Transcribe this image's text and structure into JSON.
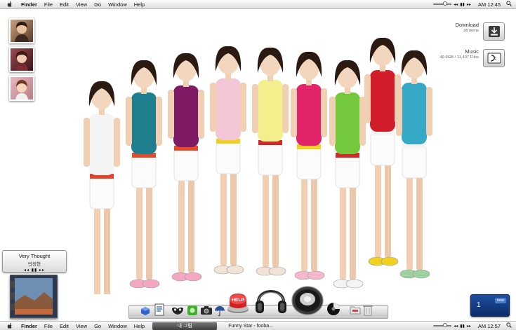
{
  "top_menubar": {
    "apple_icon": "apple-icon",
    "app_name": "Finder",
    "menu": [
      "File",
      "Edit",
      "View",
      "Go",
      "Window",
      "Help"
    ],
    "clock": "AM 12:45",
    "spotlight_icon": "magnifier-icon"
  },
  "bottom_menubar": {
    "apple_icon": "apple-icon",
    "app_name": "Finder",
    "menu": [
      "File",
      "Edit",
      "View",
      "Go",
      "Window",
      "Help"
    ],
    "task_active": "내 그림",
    "task_inactive": "Funny Star - fooba...",
    "clock": "AM 12:57",
    "spotlight_icon": "magnifier-icon"
  },
  "drives": [
    {
      "name": "Download",
      "sub": "28 items",
      "icon": "download-drive-icon"
    },
    {
      "name": "Music",
      "sub": "49.9GB / 11,407 Files",
      "icon": "music-drive-icon"
    }
  ],
  "now_playing": {
    "title": "Very Thought",
    "artist": "박정현",
    "controls": "◂◂ ▮▮ ▸▸"
  },
  "notification": {
    "count": "1",
    "badge": "new"
  },
  "colors": {
    "menubar_top": "#fbfbfb",
    "menubar_bottom": "#dedede",
    "accent_blue": "#1d4f9e",
    "help_red": "#d32222"
  },
  "dock_icons": [
    "cube-icon",
    "document-icon",
    "mask-icon",
    "green-app-icon",
    "camera-icon",
    "umbrella-icon",
    "help-button-icon",
    "headphones-icon",
    "speaker-icon",
    "disc-icon",
    "folder-icon",
    "trash-icon"
  ]
}
